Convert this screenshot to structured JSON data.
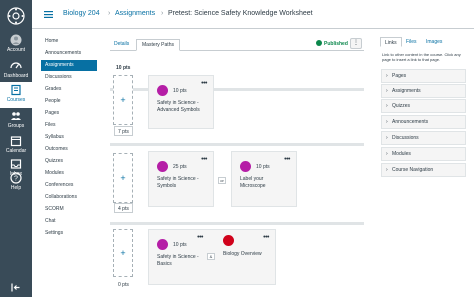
{
  "global_nav": {
    "items": [
      {
        "label": "Account",
        "icon": "account-icon"
      },
      {
        "label": "Dashboard",
        "icon": "dashboard-icon"
      },
      {
        "label": "Courses",
        "icon": "courses-icon"
      },
      {
        "label": "Groups",
        "icon": "groups-icon"
      },
      {
        "label": "Calendar",
        "icon": "calendar-icon"
      },
      {
        "label": "Inbox",
        "icon": "inbox-icon"
      },
      {
        "label": "Help",
        "icon": "help-icon"
      }
    ],
    "active": "Courses"
  },
  "breadcrumb": {
    "course": "Biology 204",
    "section": "Assignments",
    "current": "Pretest: Science Safety Knowledge Worksheet",
    "separator": "›"
  },
  "course_nav": {
    "items": [
      "Home",
      "Announcements",
      "Assignments",
      "Discussions",
      "Grades",
      "People",
      "Pages",
      "Files",
      "Syllabus",
      "Outcomes",
      "Quizzes",
      "Modules",
      "Conferences",
      "Collaborations",
      "SCORM",
      "Chat",
      "Settings"
    ],
    "active": "Assignments"
  },
  "tabs": {
    "details": "Details",
    "mastery_paths": "Mastery Paths"
  },
  "status": {
    "published": "Published",
    "more": "⋮"
  },
  "mastery_rows": [
    {
      "range_top": "10 pts",
      "range_bottom": "7 pts",
      "add": "+",
      "cards": [
        {
          "pts": "10 pts",
          "title": "Safety in Science - Advanced Symbols",
          "menu": "•••"
        }
      ]
    },
    {
      "range_bottom": "4 pts",
      "add": "+",
      "cards": [
        {
          "pts": "25 pts",
          "title": "Safety in Science - Symbols",
          "menu": "•••"
        },
        {
          "pts": "10 pts",
          "title": "Label your Microscope",
          "menu": "•••"
        }
      ],
      "joiner": "or"
    },
    {
      "range_bottom": "0 pts",
      "add": "+",
      "cards": [
        {
          "pts": "10 pts",
          "title": "Safety in Science - Basics",
          "menu": "•••"
        },
        {
          "pts": "",
          "title": "Biology Overview",
          "menu": "•••"
        }
      ],
      "joiner": "&"
    }
  ],
  "sidebar": {
    "tabs": [
      "Links",
      "Files",
      "Images"
    ],
    "help": "Link to other content in the course. Click any page to insert a link to that page.",
    "sections": [
      "Pages",
      "Assignments",
      "Quizzes",
      "Announcements",
      "Discussions",
      "Modules",
      "Course Navigation"
    ]
  },
  "colors": {
    "nav_bg": "#394b58",
    "link": "#0770a3",
    "published": "#0b874b",
    "assignment_icon": "#b51ea6",
    "page_icon": "#d0021b"
  }
}
